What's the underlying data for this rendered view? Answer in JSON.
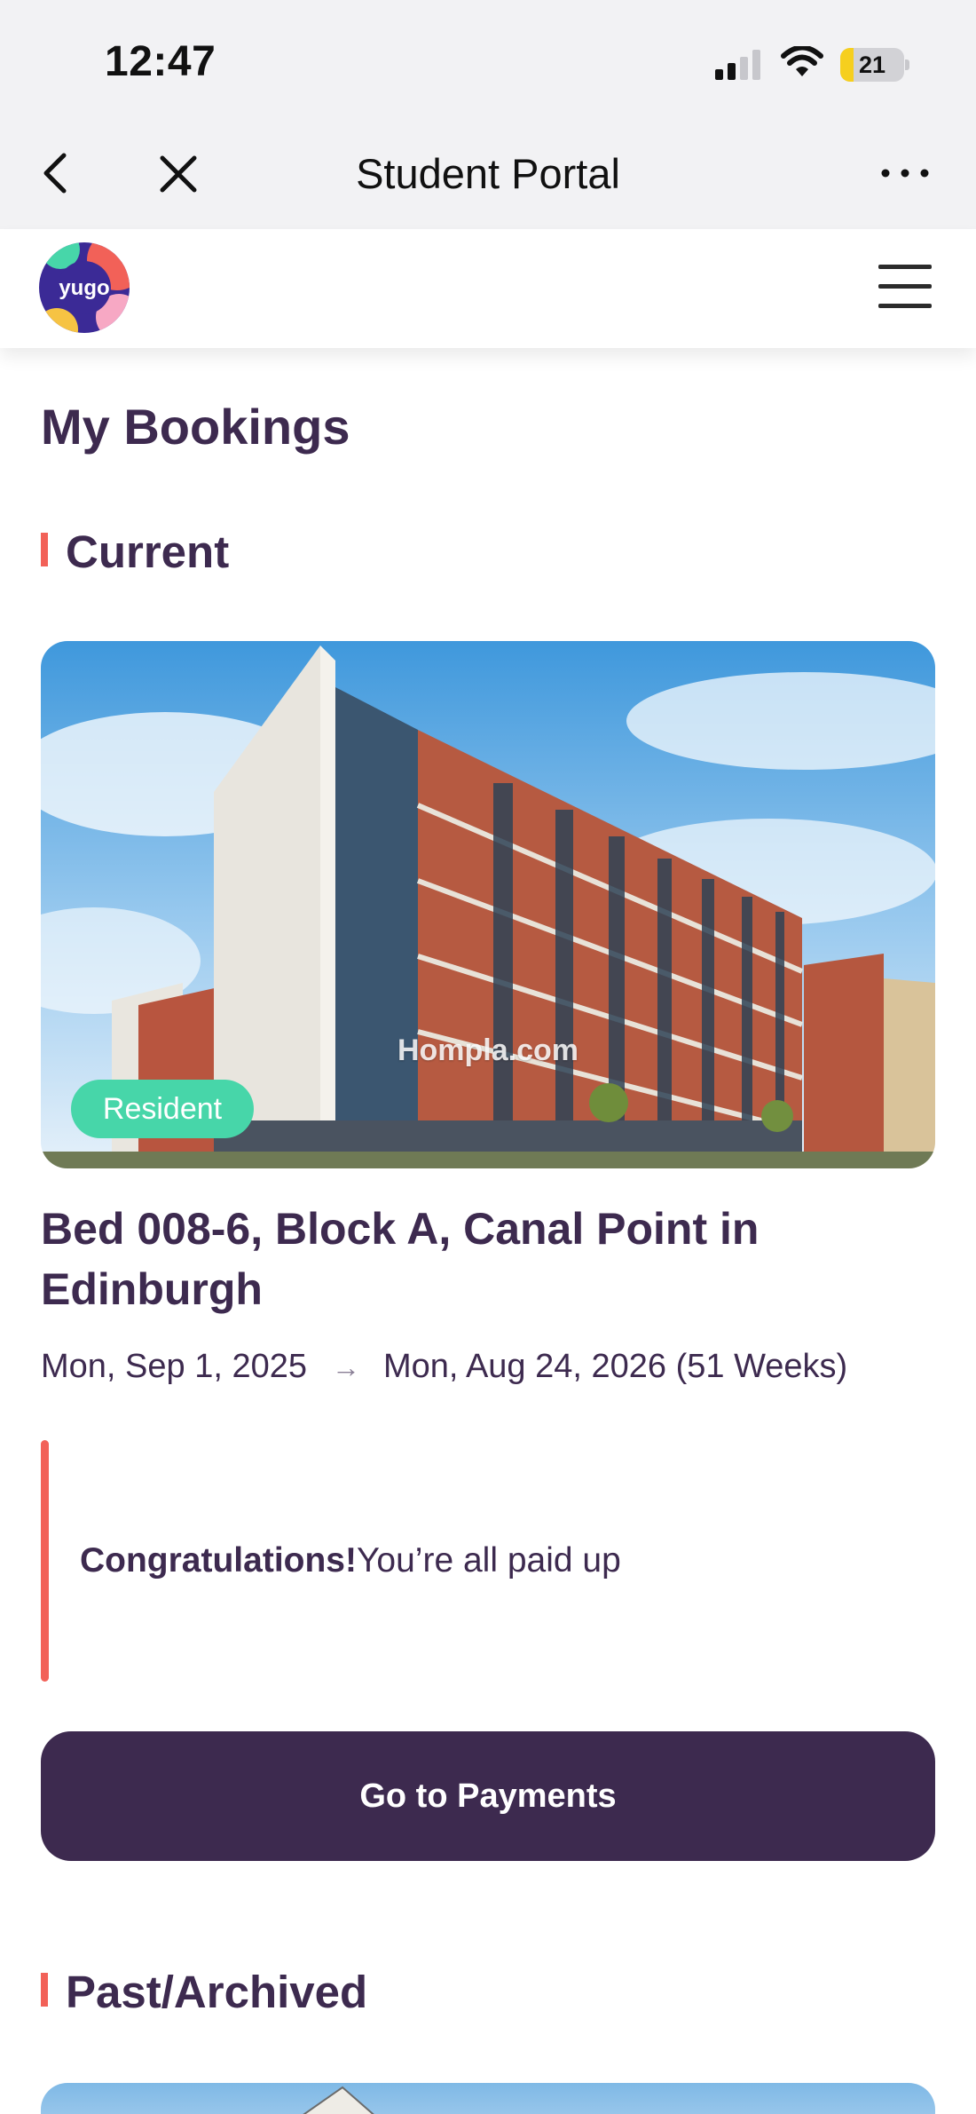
{
  "status_bar": {
    "time": "12:47",
    "battery_label": "21",
    "battery_level": 0.21,
    "battery_color": "#f6cf1e",
    "signal_bars_active": 2,
    "signal_bars_total": 4
  },
  "nav": {
    "title": "Student Portal",
    "back_icon": "chevron-left-icon",
    "close_icon": "close-icon",
    "more_icon": "more-horizontal-icon"
  },
  "header": {
    "logo_text": "yugo",
    "menu_icon": "hamburger-menu-icon"
  },
  "page": {
    "title": "My Bookings",
    "accent_color": "#f26158",
    "brand_color": "#3d2a4f"
  },
  "sections": {
    "current": "Current",
    "past": "Past/Archived"
  },
  "booking": {
    "watermark": "Hompla.com",
    "status_badge": "Resident",
    "badge_color": "#47d6a9",
    "title": "Bed 008-6, Block A, Canal Point in Edinburgh",
    "start_date": "Mon, Sep 1, 2025",
    "end_date": "Mon, Aug 24, 2026 (51 Weeks)",
    "notice_bold": "Congratulations!",
    "notice_text": "You’re all paid up",
    "payments_button": "Go to Payments"
  }
}
